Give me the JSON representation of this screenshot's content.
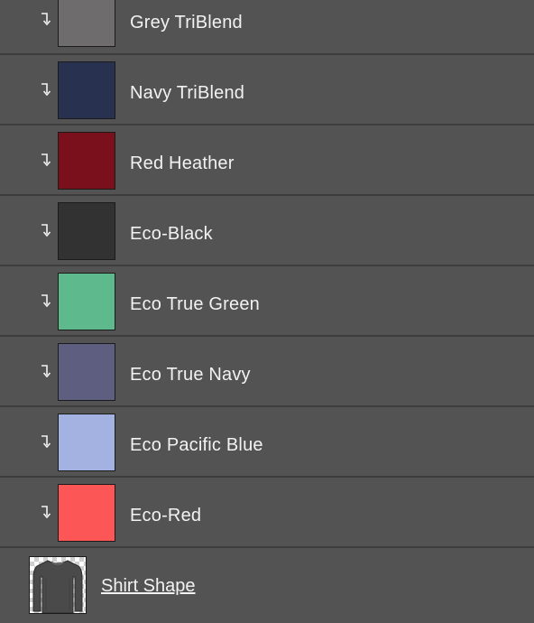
{
  "layers": [
    {
      "name": "Grey TriBlend",
      "color": "#6f6c6d"
    },
    {
      "name": "Navy TriBlend",
      "color": "#283250"
    },
    {
      "name": "Red Heather",
      "color": "#7a101c"
    },
    {
      "name": "Eco-Black",
      "color": "#323232"
    },
    {
      "name": "Eco True Green",
      "color": "#5eb98c"
    },
    {
      "name": "Eco True Navy",
      "color": "#5e5f80"
    },
    {
      "name": "Eco Pacific Blue",
      "color": "#a3b2e0"
    },
    {
      "name": "Eco-Red",
      "color": "#fc5656"
    }
  ],
  "clip_icon": "clipping-mask-arrow-icon",
  "shirt_layer": {
    "name": "Shirt Shape",
    "thumbnail_icon": "shirt-thumbnail-icon"
  },
  "colors": {
    "panel_bg": "#535353",
    "divider": "#3d3d3d",
    "text": "#f2f2f2"
  }
}
